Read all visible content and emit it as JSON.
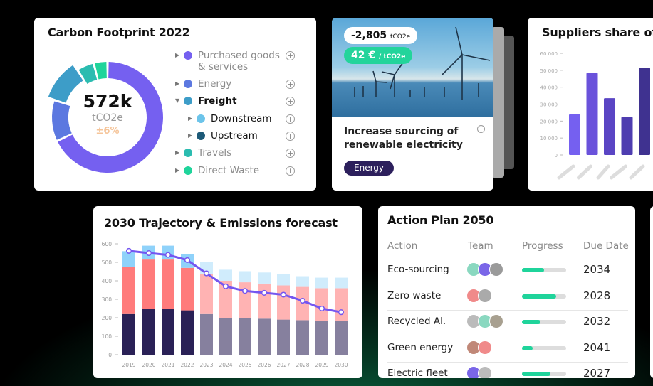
{
  "carbon": {
    "title": "Carbon Footprint 2022",
    "total": "572k",
    "unit": "tCO2e",
    "uncertainty": "±6%",
    "categories": [
      {
        "label": "Purchased goods & services",
        "color": "#7560f0",
        "share": 68,
        "expanded": false,
        "level": 0
      },
      {
        "label": "Energy",
        "color": "#5c78e0",
        "share": 12,
        "expanded": false,
        "level": 0
      },
      {
        "label": "Freight",
        "color": "#3d9dc8",
        "share": 11,
        "expanded": true,
        "level": 0
      },
      {
        "label": "Downstream",
        "color": "#6cc4ea",
        "level": 1
      },
      {
        "label": "Upstream",
        "color": "#1d5a78",
        "level": 1
      },
      {
        "label": "Travels",
        "color": "#2bbcb0",
        "share": 5,
        "expanded": false,
        "level": 0
      },
      {
        "label": "Direct Waste",
        "color": "#1fd49b",
        "share": 4,
        "expanded": false,
        "level": 0
      }
    ]
  },
  "action_card": {
    "reduction": "-2,805",
    "reduction_unit": "tCO2e",
    "price": "42 €",
    "price_unit": "/ tCO2e",
    "title": "Increase sourcing of renewable electricity",
    "tag": "Energy"
  },
  "suppliers": {
    "title": "Suppliers share of e",
    "chart_data": {
      "type": "bar",
      "yticks": [
        "60 000",
        "50 000",
        "40 000",
        "30 000",
        "20 000",
        "10 000",
        "0"
      ],
      "ylim": [
        0,
        60000
      ],
      "values": [
        24000,
        48500,
        33500,
        22500,
        51500
      ],
      "colors": [
        "#7560f0",
        "#6a52db",
        "#5a45c4",
        "#4e3db0",
        "#3f3290"
      ]
    }
  },
  "trajectory": {
    "title": "2030 Trajectory & Emissions forecast",
    "chart_data": {
      "type": "bar",
      "stacked": true,
      "ylim": [
        0,
        600
      ],
      "yticks": [
        "600",
        "500",
        "400",
        "300",
        "200",
        "100",
        "0"
      ],
      "categories": [
        "2019",
        "2020",
        "2021",
        "2022",
        "2023",
        "2024",
        "2025",
        "2026",
        "2027",
        "2028",
        "2029",
        "2030"
      ],
      "series": [
        {
          "values": [
            220,
            250,
            250,
            240,
            220,
            200,
            198,
            195,
            190,
            187,
            182,
            182
          ],
          "colors": [
            "#2a2156",
            "#86809e"
          ]
        },
        {
          "values": [
            255,
            265,
            265,
            230,
            215,
            200,
            194,
            190,
            185,
            180,
            178,
            178
          ],
          "colors": [
            "#ff7b7b",
            "#ffb3b3"
          ]
        },
        {
          "values": [
            85,
            75,
            75,
            75,
            65,
            60,
            60,
            60,
            60,
            58,
            57,
            57
          ],
          "colors": [
            "#8fd2fa",
            "#d0ecfc"
          ]
        }
      ],
      "line": {
        "values": [
          562,
          550,
          540,
          512,
          440,
          370,
          345,
          335,
          325,
          292,
          250,
          230
        ],
        "color": "#7556f0"
      },
      "actual_until": "2022"
    }
  },
  "plan": {
    "title": "Action Plan 2050",
    "headers": [
      "Action",
      "Team",
      "Progress",
      "Due Date"
    ],
    "rows": [
      {
        "action": "Eco-sourcing",
        "team": [
          "#8ad8c0",
          "#7a66e8",
          "#9a9a9a"
        ],
        "progress": 50,
        "due": "2034"
      },
      {
        "action": "Zero waste",
        "team": [
          "#f08a8a",
          "#aaaaaa"
        ],
        "progress": 78,
        "due": "2028"
      },
      {
        "action": "Recycled Al.",
        "team": [
          "#bbbbbb",
          "#8ad8c0",
          "#a8a090"
        ],
        "progress": 42,
        "due": "2032"
      },
      {
        "action": "Green energy",
        "team": [
          "#c08878",
          "#f08a8a"
        ],
        "progress": 24,
        "due": "2041"
      },
      {
        "action": "Electric fleet",
        "team": [
          "#7a66e8",
          "#bbbbbb"
        ],
        "progress": 65,
        "due": "2027"
      }
    ]
  }
}
